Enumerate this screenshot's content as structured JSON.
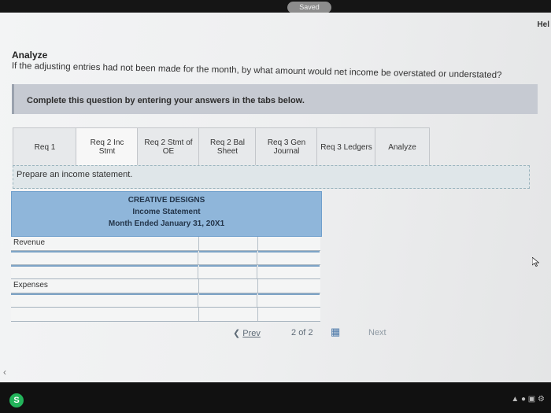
{
  "status": {
    "saved": "Saved"
  },
  "header": {
    "help": "Hel"
  },
  "question": {
    "title": "Analyze",
    "text": "If the adjusting entries had not been made for the month, by what amount would net income be overstated or understated?"
  },
  "instruction": "Complete this question by entering your answers in the tabs below.",
  "tabs": [
    {
      "label": "Req 1"
    },
    {
      "label": "Req 2 Inc\nStmt"
    },
    {
      "label": "Req 2 Stmt of\nOE"
    },
    {
      "label": "Req 2 Bal\nSheet"
    },
    {
      "label": "Req 3 Gen\nJournal"
    },
    {
      "label": "Req 3 Ledgers"
    },
    {
      "label": "Analyze"
    }
  ],
  "prepare": "Prepare an income statement.",
  "statement": {
    "company": "CREATIVE DESIGNS",
    "title": "Income Statement",
    "period": "Month Ended January 31, 20X1",
    "revenue_label": "Revenue",
    "expenses_label": "Expenses"
  },
  "navigation": {
    "prev": "Prev",
    "page_current": "2",
    "page_of": "of",
    "page_total": "2",
    "next": "Next"
  },
  "taskbar": {
    "app_letter": "S"
  }
}
